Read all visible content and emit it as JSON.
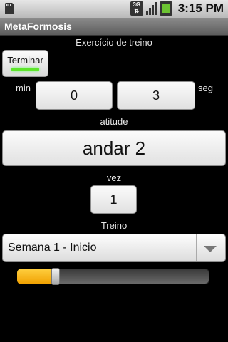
{
  "status_bar": {
    "network": "3G",
    "time": "3:15 PM",
    "icons": [
      "sd-card-icon",
      "network-3g-icon",
      "signal-icon",
      "battery-icon"
    ]
  },
  "app": {
    "title": "MetaFormosis"
  },
  "screen": {
    "heading": "Exercício de treino",
    "stop_button_label": "Terminar",
    "min_label": "min",
    "seg_label": "seg",
    "minutes_value": "0",
    "seconds_value": "3",
    "attitude_label": "atitude",
    "attitude_value": "andar 2",
    "count_label": "vez",
    "count_value": "1",
    "training_label": "Treino",
    "training_selected": "Semana 1 - Inicio",
    "progress_percent": 20
  },
  "colors": {
    "accent": "#f0a000",
    "led": "#5fe52c"
  }
}
